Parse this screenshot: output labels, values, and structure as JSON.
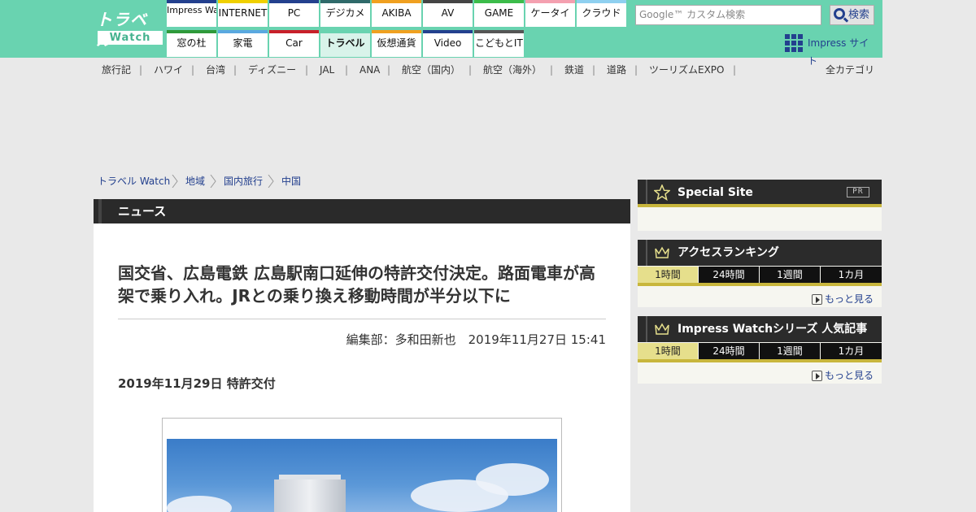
{
  "logo": {
    "top": "トラベル",
    "bottom": "Watch"
  },
  "nav": {
    "row1": [
      {
        "label": "Impress Watch",
        "color": "#23408e",
        "two_line": true
      },
      {
        "label": "INTERNET",
        "color": "#f0d000"
      },
      {
        "label": "PC",
        "color": "#23408e"
      },
      {
        "label": "デジカメ",
        "color": "#2f6a6a"
      },
      {
        "label": "AKIBA",
        "color": "#f0a020"
      },
      {
        "label": "AV",
        "color": "#444444"
      },
      {
        "label": "GAME",
        "color": "#3cbc4a"
      },
      {
        "label": "ケータイ",
        "color": "#f4a0b0"
      },
      {
        "label": "クラウド",
        "color": "#8fd0f0"
      }
    ],
    "row2": [
      {
        "label": "窓の杜",
        "color": "#2f9a3a"
      },
      {
        "label": "家電",
        "color": "#5aa8e0"
      },
      {
        "label": "Car",
        "color": "#c8202a"
      },
      {
        "label": "トラベル",
        "color": "#69d3b0",
        "active": true
      },
      {
        "label": "仮想通貨",
        "color": "#f0a020"
      },
      {
        "label": "Video",
        "color": "#23408e"
      },
      {
        "label": "こどもとIT",
        "color": "#555555"
      }
    ]
  },
  "search": {
    "placeholder": "Google™ カスタム検索",
    "button": "検索"
  },
  "impress_site": "Impress サイト",
  "categories": [
    "旅行記",
    "ハワイ",
    "台湾",
    "ディズニー",
    "JAL",
    "ANA",
    "航空（国内）",
    "航空（海外）",
    "鉄道",
    "道路",
    "ツーリズムEXPO"
  ],
  "all_categories": "全カテゴリ",
  "breadcrumb": [
    "トラベル Watch",
    "地域",
    "国内旅行",
    "中国"
  ],
  "section": "ニュース",
  "article": {
    "headline": "国交省、広島電鉄 広島駅南口延伸の特許交付決定。路面電車が高架で乗り入れ。JRとの乗り換え移動時間が半分以下に",
    "byline": "編集部：多和田新也　2019年11月27日 15:41",
    "date_heading": "2019年11月29日 特許交付"
  },
  "sidebar": {
    "special_site": {
      "title": "Special Site",
      "badge": "PR"
    },
    "ranking": {
      "title": "アクセスランキング",
      "tabs": [
        "1時間",
        "24時間",
        "1週間",
        "1カ月"
      ],
      "more": "もっと見る"
    },
    "impress_ranking": {
      "title": "Impress Watchシリーズ 人気記事",
      "tabs": [
        "1時間",
        "24時間",
        "1週間",
        "1カ月"
      ],
      "more": "もっと見る"
    }
  }
}
